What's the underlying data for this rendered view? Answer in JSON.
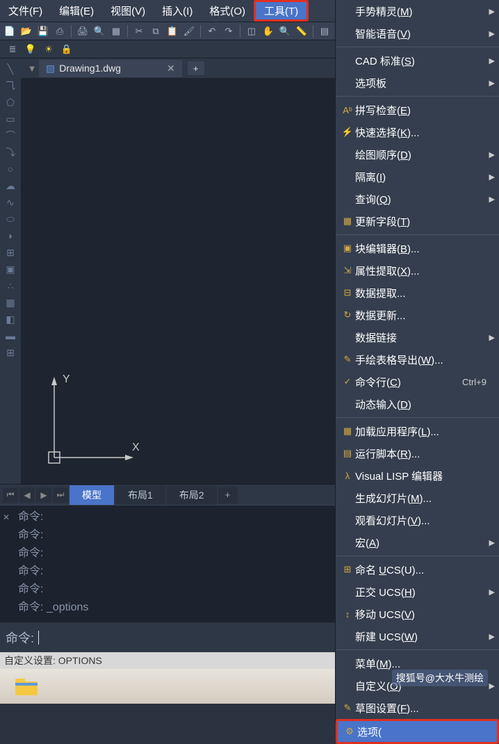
{
  "menubar": {
    "items": [
      {
        "label": "文件(F)"
      },
      {
        "label": "编辑(E)"
      },
      {
        "label": "视图(V)"
      },
      {
        "label": "插入(I)"
      },
      {
        "label": "格式(O)"
      },
      {
        "label": "工具(T)"
      }
    ]
  },
  "file_tab": {
    "name": "Drawing1.dwg"
  },
  "layout_tabs": {
    "items": [
      "模型",
      "布局1",
      "布局2"
    ]
  },
  "command_history": {
    "lines": [
      "命令:",
      "命令:",
      "命令:",
      "命令:",
      "命令:",
      "命令: _options"
    ]
  },
  "command_input": {
    "prompt": "命令:"
  },
  "status_bar": {
    "text": "自定义设置: OPTIONS"
  },
  "watermark": "搜狐号@大水牛测绘",
  "axes": {
    "x": "X",
    "y": "Y"
  },
  "tools_menu": {
    "items": [
      {
        "label": "手势精灵(M)",
        "u": "M",
        "icon": "",
        "submenu": true
      },
      {
        "label": "智能语音(V)",
        "u": "V",
        "icon": "",
        "submenu": true
      },
      {
        "sep": true
      },
      {
        "label": "CAD 标准(S)",
        "u": "S",
        "icon": "",
        "submenu": true
      },
      {
        "label": "选项板",
        "icon": "",
        "submenu": true
      },
      {
        "sep": true
      },
      {
        "label": "拼写检查(E)",
        "u": "E",
        "icon": "spell"
      },
      {
        "label": "快速选择(K)...",
        "u": "K",
        "icon": "qselect"
      },
      {
        "label": "绘图顺序(D)",
        "u": "D",
        "icon": "",
        "submenu": true
      },
      {
        "label": "隔离(I)",
        "u": "I",
        "icon": "",
        "submenu": true
      },
      {
        "label": "查询(Q)",
        "u": "Q",
        "icon": "",
        "submenu": true
      },
      {
        "label": "更新字段(T)",
        "u": "T",
        "icon": "field"
      },
      {
        "sep": true
      },
      {
        "label": "块编辑器(B)...",
        "u": "B",
        "icon": "block"
      },
      {
        "label": "属性提取(X)...",
        "u": "X",
        "icon": "attext"
      },
      {
        "label": "数据提取...",
        "icon": "dataext"
      },
      {
        "label": "数据更新...",
        "icon": "dataupd"
      },
      {
        "label": "数据链接",
        "icon": "",
        "submenu": true
      },
      {
        "label": "手绘表格导出(W)...",
        "u": "W",
        "icon": "tableexp"
      },
      {
        "label": "命令行(C)",
        "u": "C",
        "icon": "cmdline",
        "shortcut": "Ctrl+9"
      },
      {
        "label": "动态输入(D)",
        "u": "D",
        "icon": ""
      },
      {
        "sep": true
      },
      {
        "label": "加载应用程序(L)...",
        "u": "L",
        "icon": "loadapp"
      },
      {
        "label": "运行脚本(R)...",
        "u": "R",
        "icon": "script"
      },
      {
        "label": "Visual LISP 编辑器",
        "icon": "vlisp"
      },
      {
        "label": "生成幻灯片(M)...",
        "u": "M",
        "icon": ""
      },
      {
        "label": "观看幻灯片(V)...",
        "u": "V",
        "icon": ""
      },
      {
        "label": "宏(A)",
        "u": "A",
        "icon": "",
        "submenu": true
      },
      {
        "sep": true
      },
      {
        "label": "命名 UCS(U)...",
        "u": "U",
        "icon": "ucsname"
      },
      {
        "label": "正交 UCS(H)",
        "u": "H",
        "icon": "",
        "submenu": true
      },
      {
        "label": "移动 UCS(V)",
        "u": "V",
        "icon": "ucsmove"
      },
      {
        "label": "新建 UCS(W)",
        "u": "W",
        "icon": "",
        "submenu": true
      },
      {
        "sep": true
      },
      {
        "label": "菜单(M)...",
        "u": "M",
        "icon": ""
      },
      {
        "label": "自定义(O)",
        "u": "O",
        "icon": "",
        "submenu": true
      },
      {
        "label": "草图设置(F)...",
        "u": "F",
        "icon": "draft"
      },
      {
        "label": "选项(",
        "highlighted": true,
        "icon": "options"
      }
    ]
  }
}
